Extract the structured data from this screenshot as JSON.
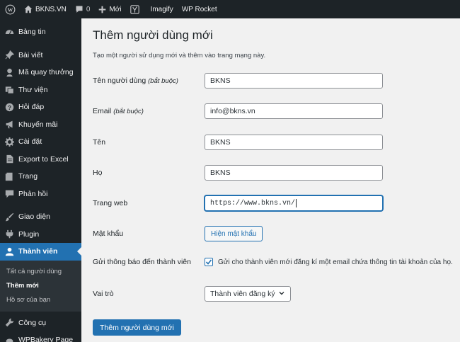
{
  "adminbar": {
    "site_name": "BKNS.VN",
    "comments_count": "0",
    "new_label": "Mới",
    "plugin_items": [
      "Imagify",
      "WP Rocket"
    ]
  },
  "sidebar": {
    "items": [
      {
        "label": "Bảng tin",
        "icon": "dashboard-icon"
      },
      {
        "label": "Bài viết",
        "icon": "pin-icon"
      },
      {
        "label": "Mã quay thưởng",
        "icon": "badge-icon"
      },
      {
        "label": "Thư viện",
        "icon": "media-icon"
      },
      {
        "label": "Hỏi đáp",
        "icon": "question-icon"
      },
      {
        "label": "Khuyến mãi",
        "icon": "megaphone-icon"
      },
      {
        "label": "Cài đặt",
        "icon": "gear-icon"
      },
      {
        "label": "Export to Excel",
        "icon": "document-icon"
      },
      {
        "label": "Trang",
        "icon": "page-icon"
      },
      {
        "label": "Phản hồi",
        "icon": "comment-icon"
      },
      {
        "label": "Giao diện",
        "icon": "brush-icon"
      },
      {
        "label": "Plugin",
        "icon": "plug-icon"
      },
      {
        "label": "Thành viên",
        "icon": "user-icon"
      },
      {
        "label": "Công cụ",
        "icon": "wrench-icon"
      },
      {
        "label": "WPBakery Page",
        "icon": "bakery-icon"
      }
    ],
    "submenu": [
      "Tất cả người dùng",
      "Thêm mới",
      "Hồ sơ của bạn"
    ]
  },
  "page": {
    "title": "Thêm người dùng mới",
    "intro": "Tạo một người sử dụng mới và thêm vào trang mạng này.",
    "fields": {
      "username": {
        "label": "Tên người dùng",
        "note": "(bắt buộc)",
        "value": "BKNS"
      },
      "email": {
        "label": "Email",
        "note": "(bắt buộc)",
        "value": "info@bkns.vn"
      },
      "first_name": {
        "label": "Tên",
        "value": "BKNS"
      },
      "last_name": {
        "label": "Họ",
        "value": "BKNS"
      },
      "website": {
        "label": "Trang web",
        "value": "https://www.bkns.vn/"
      },
      "password": {
        "label": "Mật khẩu",
        "button": "Hiện mật khẩu"
      },
      "notify": {
        "label": "Gửi thông báo đến thành viên",
        "checked": true,
        "text": "Gửi cho thành viên mới đăng kí một email chứa thông tin tài khoản của họ."
      },
      "role": {
        "label": "Vai trò",
        "value": "Thành viên đăng ký"
      }
    },
    "submit": "Thêm người dùng mới"
  },
  "colors": {
    "accent": "#2271b1",
    "sidebar_bg": "#1d2327",
    "content_bg": "#f1f1f1"
  }
}
